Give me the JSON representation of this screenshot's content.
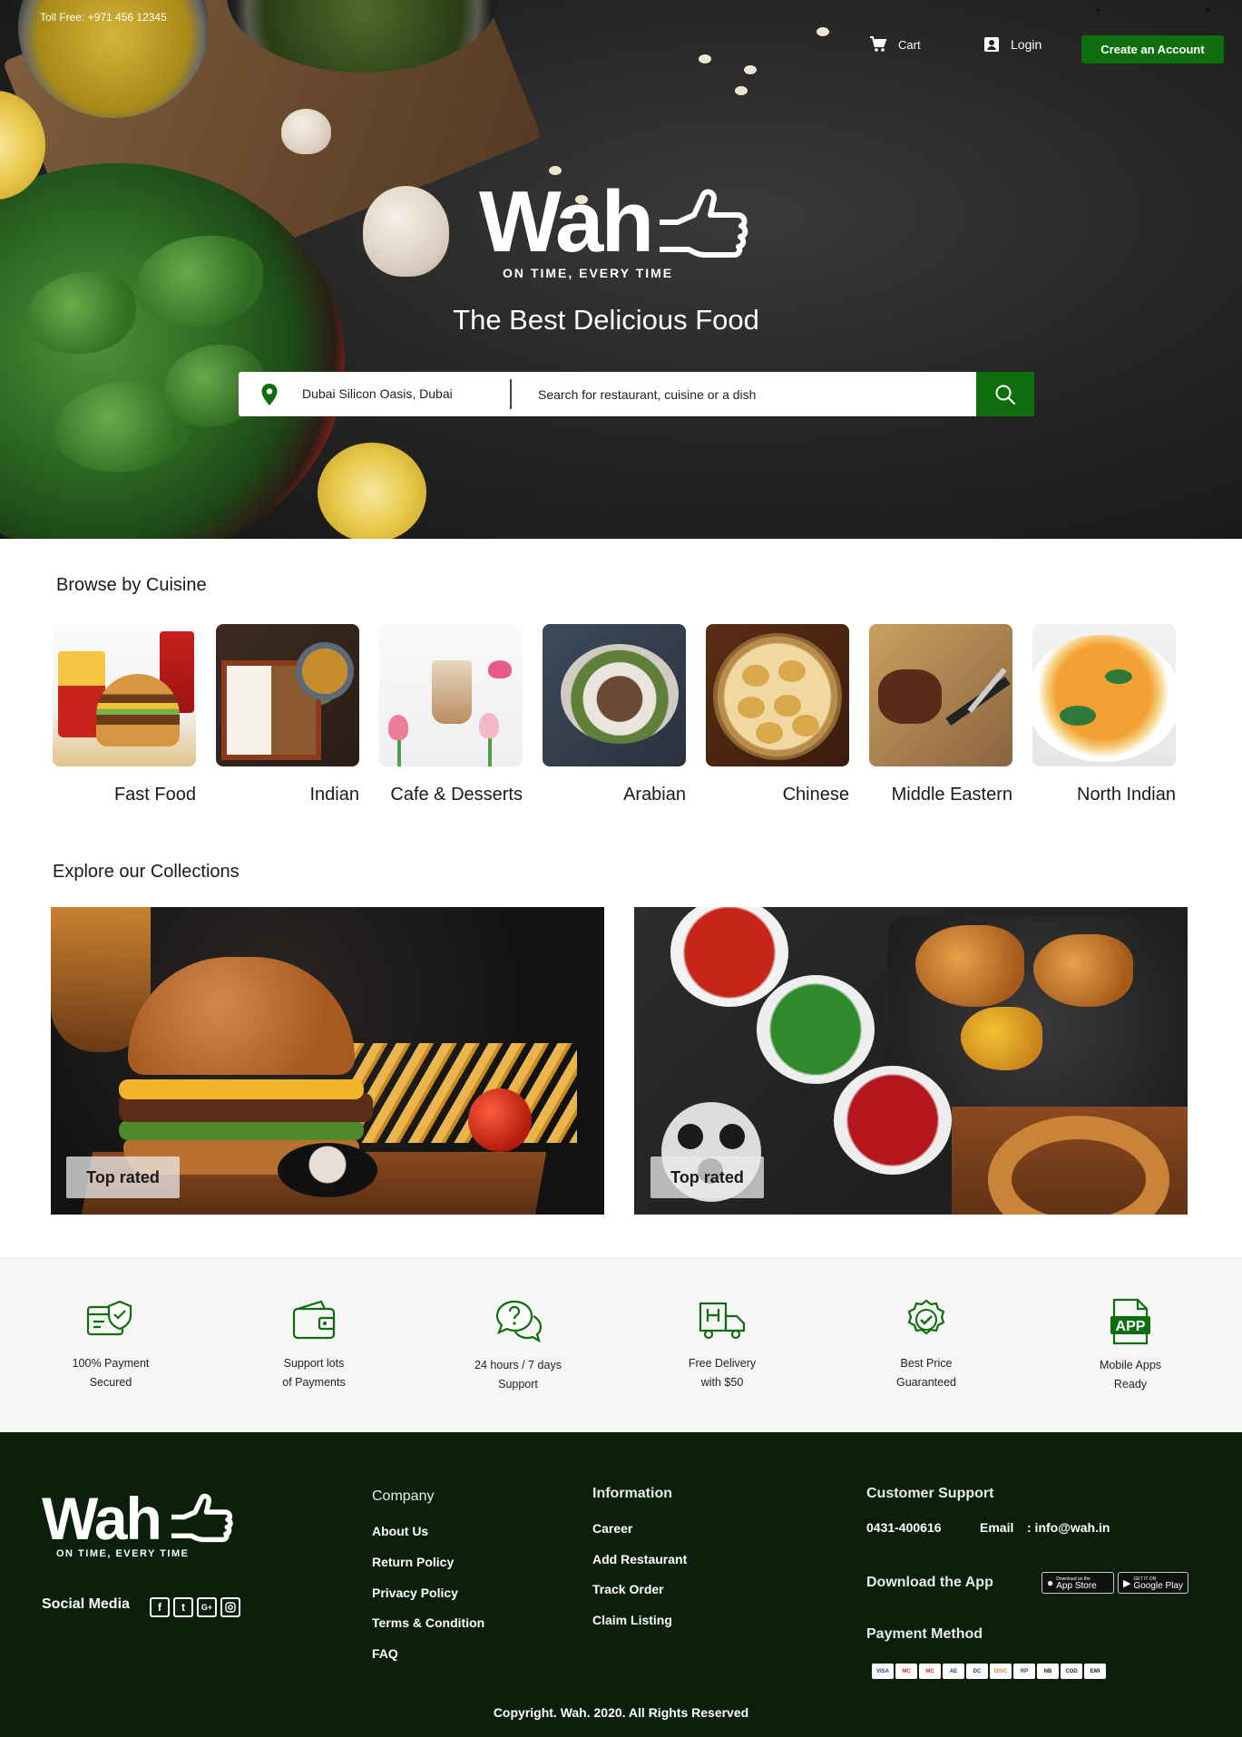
{
  "header": {
    "toll_free": "Toll Free: +971 456 12345",
    "cart_label": "Cart",
    "login_label": "Login",
    "create_account_label": "Create an Account"
  },
  "brand": {
    "name": "Wah",
    "tagline": "ON TIME, EVERY TIME"
  },
  "hero": {
    "title": "The Best Delicious Food",
    "location": "Dubai Silicon Oasis, Dubai",
    "search_placeholder": "Search for restaurant, cuisine or a dish"
  },
  "cuisine_section": {
    "title": "Browse by Cuisine",
    "items": [
      {
        "label": "Fast Food"
      },
      {
        "label": "Indian"
      },
      {
        "label": "Cafe & Desserts"
      },
      {
        "label": "Arabian"
      },
      {
        "label": "Chinese"
      },
      {
        "label": "Middle Eastern"
      },
      {
        "label": "North Indian"
      }
    ]
  },
  "collections_section": {
    "title": "Explore our Collections",
    "items": [
      {
        "badge": "Top rated"
      },
      {
        "badge": "Top rated"
      }
    ]
  },
  "features": [
    {
      "text": "100% Payment\nSecured",
      "icon": "shield-card-icon"
    },
    {
      "text": "Support lots\nof Payments",
      "icon": "wallet-icon"
    },
    {
      "text": "24 hours / 7 days\nSupport",
      "icon": "chat-help-icon"
    },
    {
      "text": "Free Delivery\nwith $50",
      "icon": "delivery-truck-icon"
    },
    {
      "text": "Best Price\nGuaranteed",
      "icon": "badge-check-icon"
    },
    {
      "text": "Mobile Apps\nReady",
      "icon": "app-file-icon"
    }
  ],
  "footer": {
    "social_label": "Social Media",
    "company": {
      "title": "Company",
      "links": [
        "About Us",
        "Return Policy",
        "Privacy Policy",
        "Terms & Condition",
        "FAQ"
      ]
    },
    "information": {
      "title": "Information",
      "links": [
        "Career",
        "Add Restaurant",
        "Track Order",
        "Claim Listing"
      ]
    },
    "support": {
      "title": "Customer Support",
      "phone": "0431-400616",
      "email_label": "Email",
      "email": ": info@wah.in",
      "download_label": "Download the App",
      "app_store": "App Store",
      "app_store_small": "Download on the",
      "google_play": "Google Play",
      "google_play_small": "GET IT ON",
      "payment_label": "Payment Method",
      "payment_methods": [
        "VISA",
        "MC",
        "MC",
        "AE",
        "DC",
        "DISC",
        "RP",
        "NB",
        "COD",
        "EMI"
      ]
    },
    "copyright": "Copyright. Wah. 2020. All Rights Reserved"
  },
  "colors": {
    "accent_green": "#0e6e0e",
    "footer_bg": "#0a200a",
    "features_bg": "#f6f6f6"
  }
}
